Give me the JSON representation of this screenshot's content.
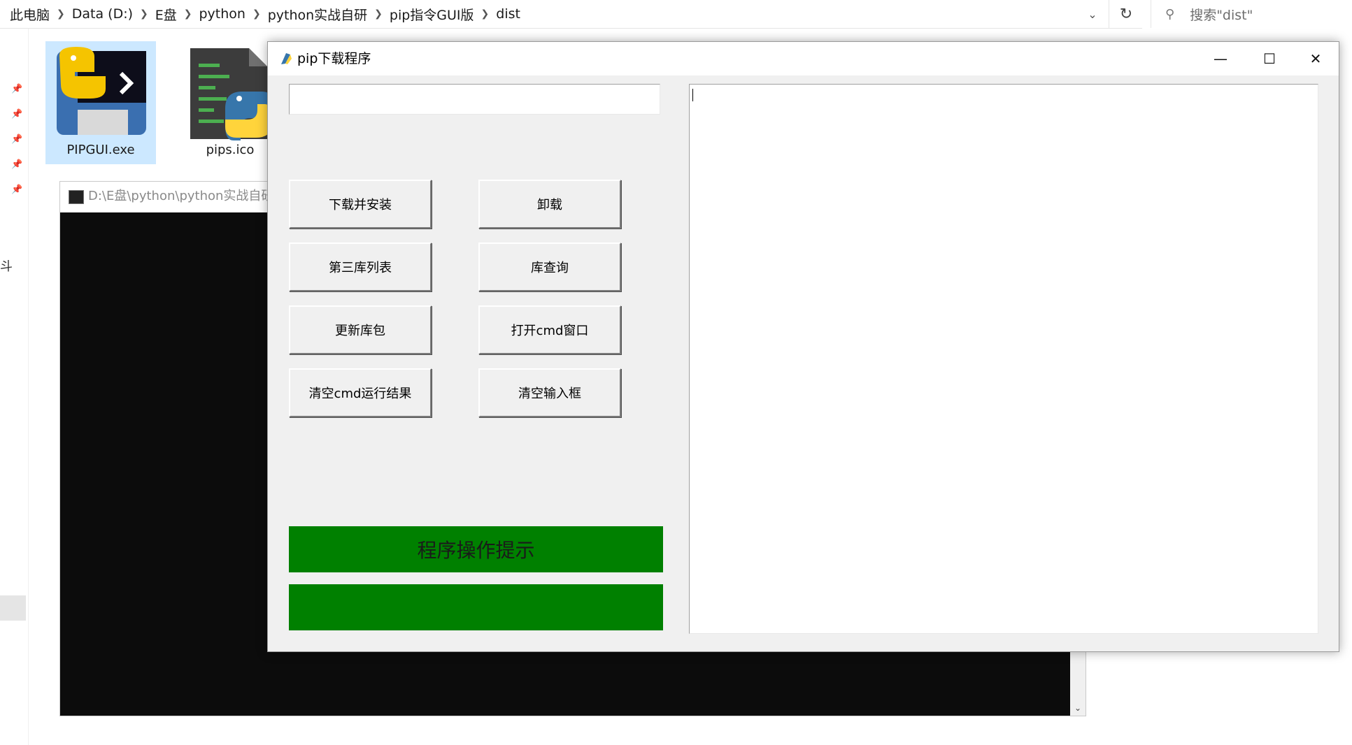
{
  "explorer": {
    "breadcrumb": [
      "此电脑",
      "Data (D:)",
      "E盘",
      "python",
      "python实战自研",
      "pip指令GUI版",
      "dist"
    ],
    "search_placeholder": "搜索\"dist\"",
    "nav_partial_char": "斗",
    "files": [
      {
        "label": "PIPGUI.exe",
        "icon": "python-launcher-icon",
        "selected": true
      },
      {
        "label": "pips.ico",
        "icon": "python-script-icon",
        "selected": false
      }
    ]
  },
  "console": {
    "title": "D:\\E盘\\python\\python实战自研"
  },
  "app": {
    "title": "pip下载程序",
    "input_value": "",
    "output_text": "",
    "buttons": {
      "install": "下载并安装",
      "uninstall": "卸载",
      "list": "第三库列表",
      "query": "库查询",
      "update": "更新库包",
      "open_cmd": "打开cmd窗口",
      "clear_result": "清空cmd运行结果",
      "clear_input": "清空输入框"
    },
    "hint_label": "程序操作提示",
    "status_text": "",
    "colors": {
      "status_bar": "#008000",
      "window_bg": "#f0f0f0"
    }
  }
}
